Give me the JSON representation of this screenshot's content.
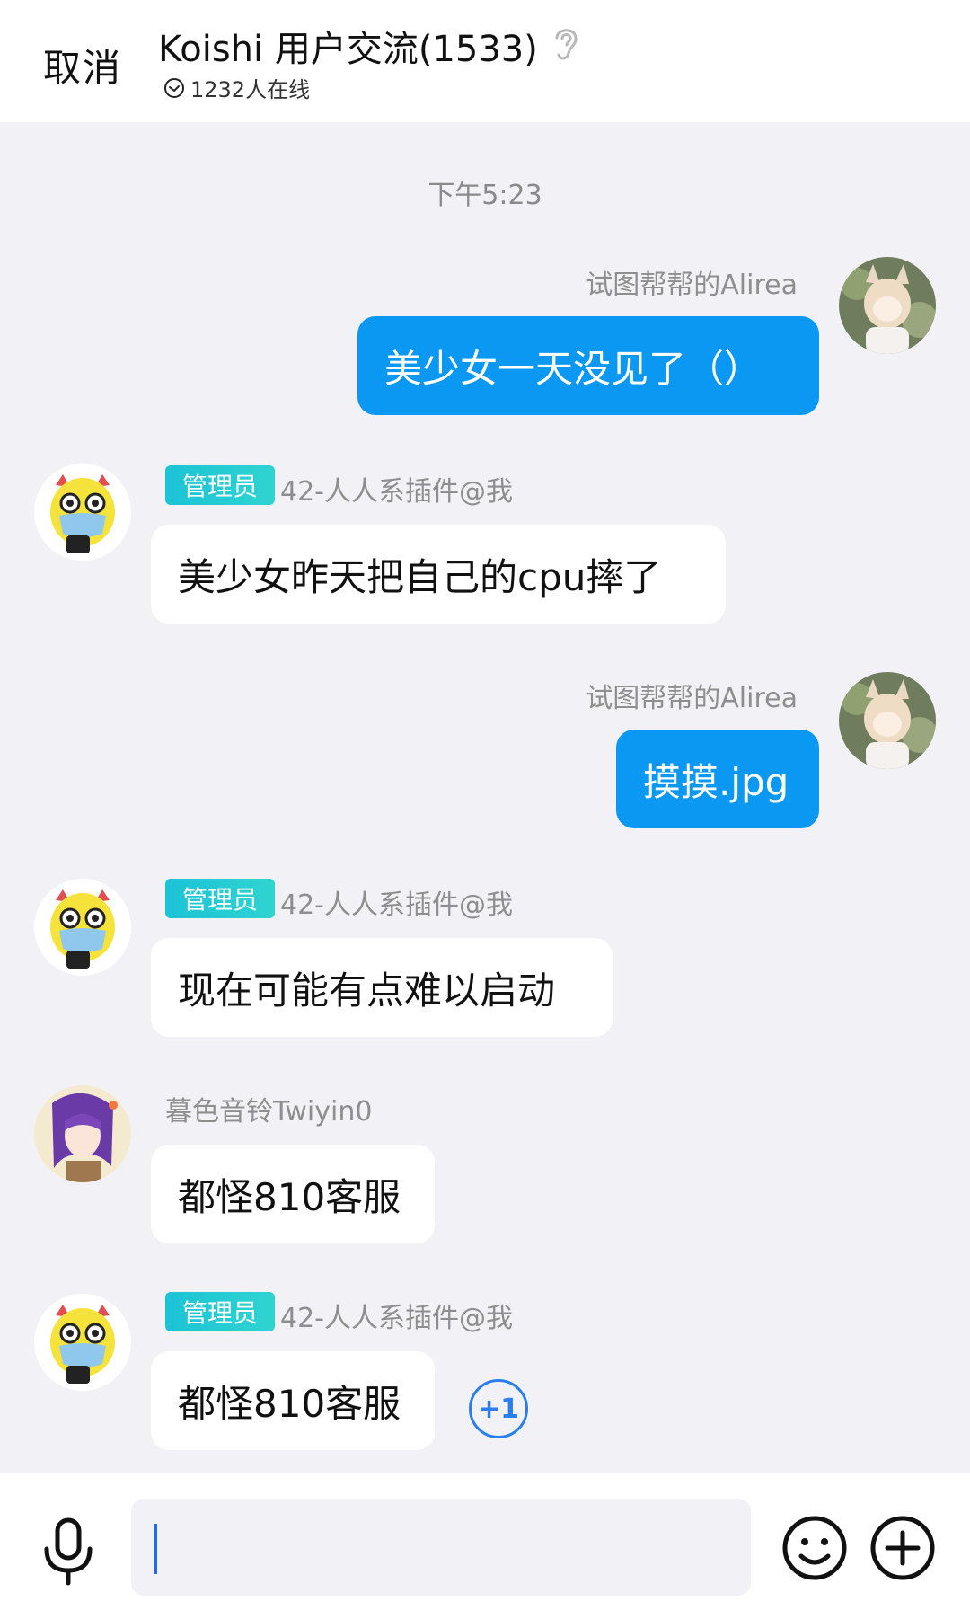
{
  "header": {
    "cancel_label": "取消",
    "title": "Koishi 用户交流(1533)",
    "online_text": "1232人在线"
  },
  "timestamp": "下午5:23",
  "messages": [
    {
      "direction": "out",
      "sender": "试图帮帮的Alirea",
      "text": "美少女一天没见了（）"
    },
    {
      "direction": "in",
      "role": "管理员",
      "sender": "42-人人系插件@我",
      "text": "美少女昨天把自己的cpu摔了"
    },
    {
      "direction": "out",
      "sender": "试图帮帮的Alirea",
      "text": "摸摸.jpg"
    },
    {
      "direction": "in",
      "role": "管理员",
      "sender": "42-人人系插件@我",
      "text": "现在可能有点难以启动"
    },
    {
      "direction": "in",
      "sender": "暮色音铃Twiyin0",
      "text": "都怪810客服"
    },
    {
      "direction": "in",
      "role": "管理员",
      "sender": "42-人人系插件@我",
      "text": "都怪810客服",
      "plus_one": "+1"
    }
  ],
  "input": {
    "value": "",
    "placeholder": ""
  },
  "icons": {
    "online": "check-circle-icon",
    "ear": "ear-icon",
    "mic": "microphone-icon",
    "emoji": "emoji-icon",
    "add": "plus-circle-icon"
  },
  "colors": {
    "out_bubble": "#0b98f3",
    "badge": "#1bc3d6",
    "plus_one": "#2a7ef0",
    "background": "#f2f2f6"
  }
}
